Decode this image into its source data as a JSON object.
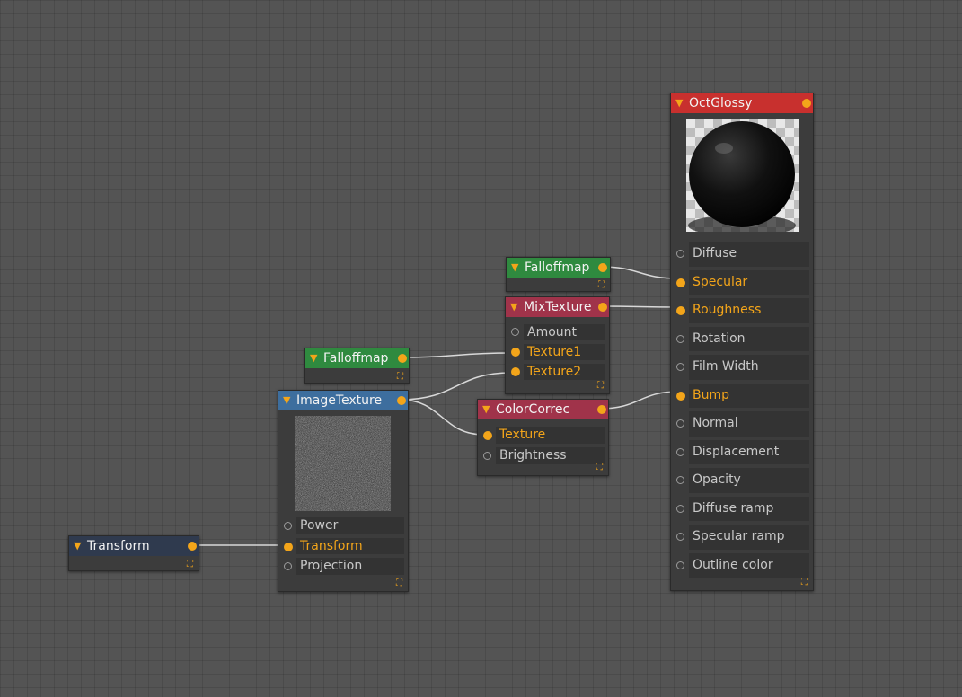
{
  "nodes": {
    "octglossy": {
      "title": "OctGlossy",
      "header_color": "#c8302e",
      "inputs": [
        {
          "label": "Diffuse",
          "connected": false
        },
        {
          "label": "Specular",
          "connected": true
        },
        {
          "label": "Roughness",
          "connected": true
        },
        {
          "label": "Rotation",
          "connected": false
        },
        {
          "label": "Film Width",
          "connected": false
        },
        {
          "label": "Bump",
          "connected": true
        },
        {
          "label": "Normal",
          "connected": false
        },
        {
          "label": "Displacement",
          "connected": false
        },
        {
          "label": "Opacity",
          "connected": false
        },
        {
          "label": "Diffuse ramp",
          "connected": false
        },
        {
          "label": "Specular ramp",
          "connected": false
        },
        {
          "label": "Outline color",
          "connected": false
        }
      ]
    },
    "falloffmap_top": {
      "title": "Falloffmap",
      "header_color": "#2f8a3f"
    },
    "mixtexture": {
      "title": "MixTexture",
      "header_color": "#a0334a",
      "inputs": [
        {
          "label": "Amount",
          "connected": false
        },
        {
          "label": "Texture1",
          "connected": true
        },
        {
          "label": "Texture2",
          "connected": true
        }
      ]
    },
    "falloffmap_left": {
      "title": "Falloffmap",
      "header_color": "#2f8a3f"
    },
    "imagetexture": {
      "title": "ImageTexture",
      "header_color": "#3d6e9e",
      "inputs": [
        {
          "label": "Power",
          "connected": false
        },
        {
          "label": "Transform",
          "connected": true
        },
        {
          "label": "Projection",
          "connected": false
        }
      ]
    },
    "colorcorrect": {
      "title": "ColorCorrec",
      "header_color": "#a0334a",
      "inputs": [
        {
          "label": "Texture",
          "connected": true
        },
        {
          "label": "Brightness",
          "connected": false
        }
      ]
    },
    "transform": {
      "title": "Transform",
      "header_color": "#2f3a4e"
    }
  },
  "colors": {
    "accent": "#f3a51a",
    "wire": "#d8d8d8",
    "canvas": "#545454"
  }
}
